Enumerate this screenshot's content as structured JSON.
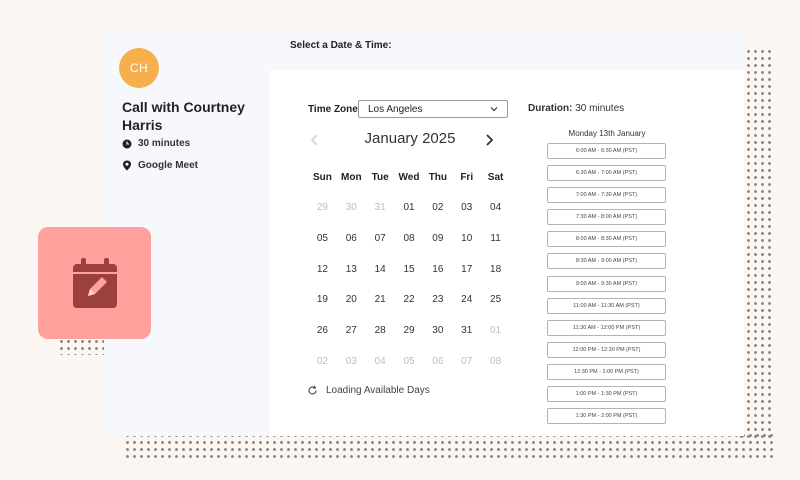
{
  "sidebar": {
    "avatar_initials": "CH",
    "event_title": "Call with Courtney Harris",
    "duration": "30 minutes",
    "location": "Google Meet"
  },
  "main": {
    "heading": "Select a Date & Time:",
    "timezone_label": "Time Zone:",
    "timezone_value": "Los Angeles",
    "duration_label": "Duration:",
    "duration_value": "30 minutes",
    "month_label": "January 2025",
    "weekdays": [
      "Sun",
      "Mon",
      "Tue",
      "Wed",
      "Thu",
      "Fri",
      "Sat"
    ],
    "days": [
      {
        "label": "29",
        "muted": true
      },
      {
        "label": "30",
        "muted": true
      },
      {
        "label": "31",
        "muted": true
      },
      {
        "label": "01",
        "muted": false
      },
      {
        "label": "02",
        "muted": false
      },
      {
        "label": "03",
        "muted": false
      },
      {
        "label": "04",
        "muted": false
      },
      {
        "label": "05",
        "muted": false
      },
      {
        "label": "06",
        "muted": false
      },
      {
        "label": "07",
        "muted": false
      },
      {
        "label": "08",
        "muted": false
      },
      {
        "label": "09",
        "muted": false
      },
      {
        "label": "10",
        "muted": false
      },
      {
        "label": "11",
        "muted": false
      },
      {
        "label": "12",
        "muted": false
      },
      {
        "label": "13",
        "muted": false
      },
      {
        "label": "14",
        "muted": false
      },
      {
        "label": "15",
        "muted": false
      },
      {
        "label": "16",
        "muted": false
      },
      {
        "label": "17",
        "muted": false
      },
      {
        "label": "18",
        "muted": false
      },
      {
        "label": "19",
        "muted": false
      },
      {
        "label": "20",
        "muted": false
      },
      {
        "label": "21",
        "muted": false
      },
      {
        "label": "22",
        "muted": false
      },
      {
        "label": "23",
        "muted": false
      },
      {
        "label": "24",
        "muted": false
      },
      {
        "label": "25",
        "muted": false
      },
      {
        "label": "26",
        "muted": false
      },
      {
        "label": "27",
        "muted": false
      },
      {
        "label": "28",
        "muted": false
      },
      {
        "label": "29",
        "muted": false
      },
      {
        "label": "30",
        "muted": false
      },
      {
        "label": "31",
        "muted": false
      },
      {
        "label": "01",
        "muted": true
      },
      {
        "label": "02",
        "muted": true
      },
      {
        "label": "03",
        "muted": true
      },
      {
        "label": "04",
        "muted": true
      },
      {
        "label": "05",
        "muted": true
      },
      {
        "label": "06",
        "muted": true
      },
      {
        "label": "07",
        "muted": true
      },
      {
        "label": "08",
        "muted": true
      }
    ],
    "loading_text": "Loading Available Days",
    "slots_date": "Monday 13th January",
    "time_slots": [
      "6:00 AM - 6:30 AM (PST)",
      "6:30 AM - 7:00 AM (PST)",
      "7:00 AM - 7:30 AM (PST)",
      "7:30 AM - 8:00 AM (PST)",
      "8:00 AM - 8:30 AM (PST)",
      "8:30 AM - 9:00 AM (PST)",
      "9:00 AM - 9:30 AM (PST)",
      "11:00 AM - 11:30 AM (PST)",
      "11:30 AM - 12:00 PM (PST)",
      "12:00 PM - 12:30 PM (PST)",
      "12:30 PM - 1:00 PM (PST)",
      "1:00 PM - 1:30 PM (PST)",
      "1:30 PM - 2:00 PM (PST)"
    ]
  },
  "icons": {
    "avatar": "avatar",
    "duration": "clock-icon",
    "location": "location-pin-icon",
    "prev": "chevron-left-icon",
    "next": "chevron-right-icon",
    "dropdown": "chevron-down-icon",
    "loading": "refresh-icon",
    "badge": "calendar-edit-icon"
  },
  "colors": {
    "background": "#fbf6f1",
    "avatar": "#f5b04d",
    "badge": "#ffa19c",
    "badge_icon": "#9b3f3f"
  }
}
